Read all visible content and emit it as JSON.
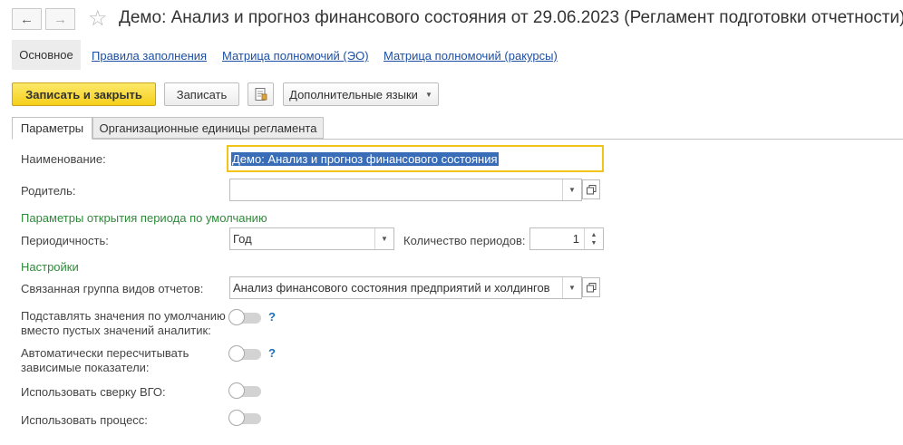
{
  "window": {
    "title": "Демо: Анализ и прогноз финансового состояния от 29.06.2023 (Регламент подготовки отчетности)"
  },
  "nav": {
    "items": [
      {
        "label": "Основное"
      },
      {
        "label": "Правила заполнения"
      },
      {
        "label": "Матрица полномочий (ЭО)"
      },
      {
        "label": "Матрица полномочий (ракурсы)"
      }
    ]
  },
  "toolbar": {
    "save_close_label": "Записать и закрыть",
    "save_label": "Записать",
    "languages_label": "Дополнительные языки"
  },
  "tabs": [
    {
      "label": "Параметры"
    },
    {
      "label": "Организационные единицы регламента"
    }
  ],
  "form": {
    "name_label": "Наименование:",
    "name_value": "Демо: Анализ и прогноз финансового состояния",
    "parent_label": "Родитель:",
    "parent_value": "",
    "period_section": "Параметры открытия периода  по умолчанию",
    "periodicity_label": "Периодичность:",
    "periodicity_value": "Год",
    "period_count_label": "Количество периодов:",
    "period_count_value": "1",
    "settings_section": "Настройки",
    "report_group_label": "Связанная группа видов отчетов:",
    "report_group_value": "Анализ финансового состояния предприятий и холдингов",
    "substitute_label_1": "Подставлять значения по умолчанию",
    "substitute_label_2": "вместо пустых значений аналитик:",
    "recalc_label_1": "Автоматически пересчитывать",
    "recalc_label_2": "зависимые показатели:",
    "vgo_label": "Использовать сверку ВГО:",
    "process_label": "Использовать процесс:",
    "help_mark": "?"
  }
}
